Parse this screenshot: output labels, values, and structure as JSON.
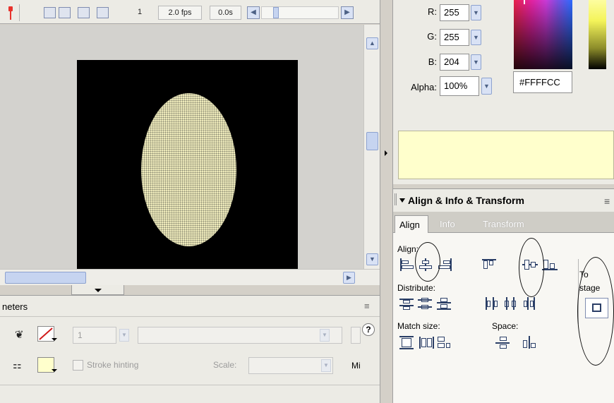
{
  "timeline": {
    "current_frame": "1",
    "frame_rate": "2.0 fps",
    "elapsed_time": "0.0s"
  },
  "stage": {
    "background_color": "#000000",
    "shape_fill_color": "#FFFFCC"
  },
  "properties_panel": {
    "title_fragment": "neters",
    "stroke_size": "1",
    "stroke_hinting_label": "Stroke hinting",
    "scale_label": "Scale:",
    "miter_fragment": "Mi",
    "help_icon": "?"
  },
  "color_mixer": {
    "r_label": "R:",
    "r_value": "255",
    "g_label": "G:",
    "g_value": "255",
    "b_label": "B:",
    "b_value": "204",
    "alpha_label": "Alpha:",
    "alpha_value": "100%",
    "hex_value": "#FFFFCC",
    "preview_color": "#FFFFCC"
  },
  "align_panel": {
    "title": "Align & Info & Transform",
    "tabs": [
      "Align",
      "Info",
      "Transform"
    ],
    "active_tab": "Align",
    "align_label": "Align:",
    "distribute_label": "Distribute:",
    "match_size_label": "Match size:",
    "space_label": "Space:",
    "to_stage_label_1": "To",
    "to_stage_label_2": "stage"
  }
}
